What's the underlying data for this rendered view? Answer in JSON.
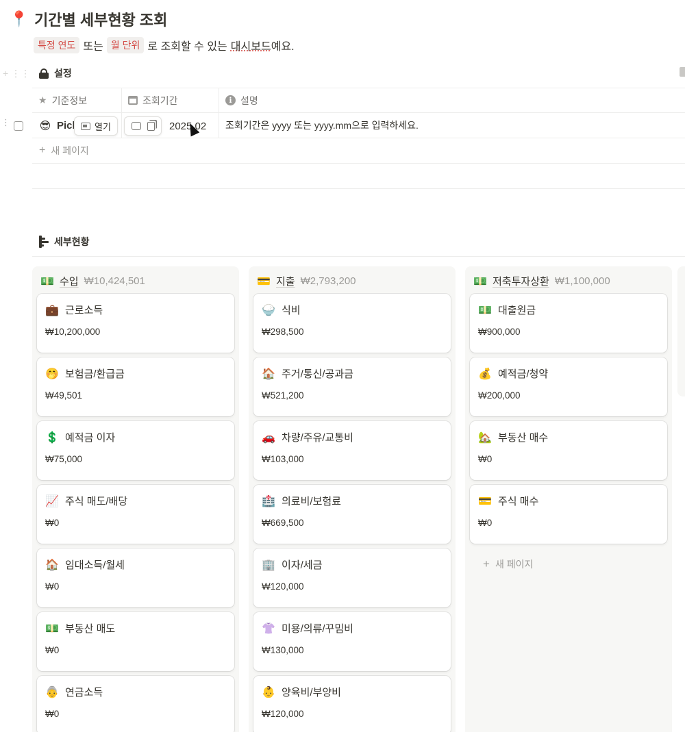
{
  "page": {
    "title_icon": "📍",
    "title": "기간별 세부현황 조회",
    "subtitle": {
      "tag1": "특정 연도",
      "text1": "또는",
      "tag2": "월 단위",
      "text2": "로 조회할 수 있는",
      "link": "대시보드",
      "text3": "예요."
    }
  },
  "settings": {
    "heading": "설정",
    "columns": [
      "기준정보",
      "조회기간",
      "설명"
    ],
    "row": {
      "emoji": "😎",
      "name": "Pick",
      "open_label": "열기",
      "period": "2025.02",
      "description": "조회기간은 yyyy 또는 yyyy.mm으로 입력하세요."
    },
    "new_page": "새 페이지"
  },
  "board": {
    "heading": "세부현황",
    "new_page": "새 페이지",
    "columns": [
      {
        "icon": "💵",
        "title": "수입",
        "total": "₩10,424,501",
        "cards": [
          {
            "icon": "💼",
            "title": "근로소득",
            "amount": "₩10,200,000"
          },
          {
            "icon": "🤭",
            "title": "보험금/환급금",
            "amount": "₩49,501"
          },
          {
            "icon": "💲",
            "title": "예적금 이자",
            "amount": "₩75,000"
          },
          {
            "icon": "📈",
            "title": "주식 매도/배당",
            "amount": "₩0"
          },
          {
            "icon": "🏠",
            "title": "임대소득/월세",
            "amount": "₩0"
          },
          {
            "icon": "💵",
            "title": "부동산 매도",
            "amount": "₩0"
          },
          {
            "icon": "👵",
            "title": "연금소득",
            "amount": "₩0"
          }
        ]
      },
      {
        "icon": "💳",
        "title": "지출",
        "total": "₩2,793,200",
        "cards": [
          {
            "icon": "🍚",
            "title": "식비",
            "amount": "₩298,500"
          },
          {
            "icon": "🏠",
            "title": "주거/통신/공과금",
            "amount": "₩521,200"
          },
          {
            "icon": "🚗",
            "title": "차량/주유/교통비",
            "amount": "₩103,000"
          },
          {
            "icon": "🏥",
            "title": "의료비/보험료",
            "amount": "₩669,500"
          },
          {
            "icon": "🏢",
            "title": "이자/세금",
            "amount": "₩120,000"
          },
          {
            "icon": "👚",
            "title": "미용/의류/꾸밈비",
            "amount": "₩130,000"
          },
          {
            "icon": "👶",
            "title": "양육비/부양비",
            "amount": "₩120,000"
          }
        ]
      },
      {
        "icon": "💵",
        "title": "저축투자상환",
        "total": "₩1,100,000",
        "cards": [
          {
            "icon": "💵",
            "title": "대출원금",
            "amount": "₩900,000"
          },
          {
            "icon": "💰",
            "title": "예적금/청약",
            "amount": "₩200,000"
          },
          {
            "icon": "🏡",
            "title": "부동산 매수",
            "amount": "₩0"
          },
          {
            "icon": "💳",
            "title": "주식 매수",
            "amount": "₩0"
          }
        ]
      }
    ]
  }
}
